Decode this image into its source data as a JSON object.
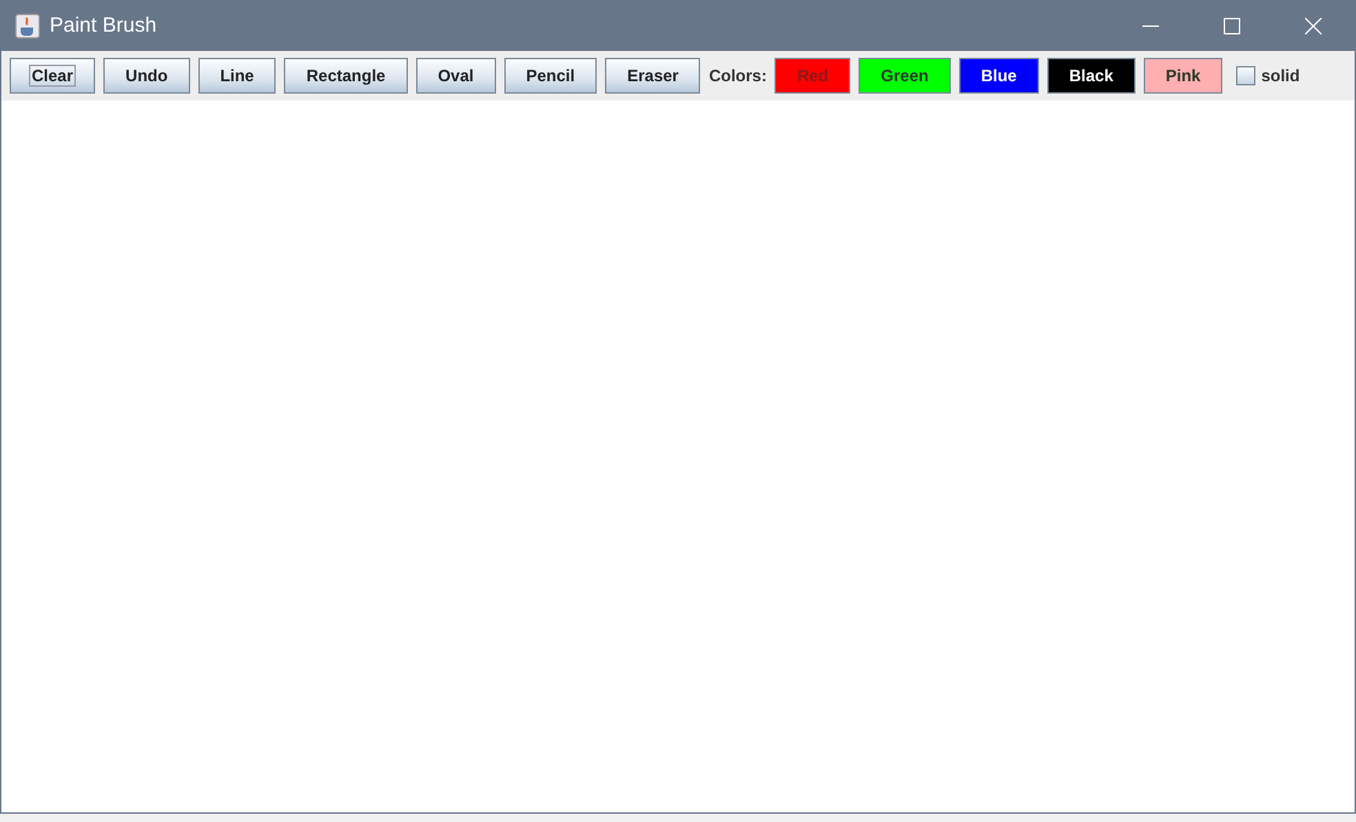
{
  "window": {
    "title": "Paint Brush"
  },
  "toolbar": {
    "buttons": [
      {
        "label": "Clear",
        "kind": "tool",
        "focused": true
      },
      {
        "label": "Undo",
        "kind": "tool",
        "focused": false
      },
      {
        "label": "Line",
        "kind": "tool",
        "focused": false
      },
      {
        "label": "Rectangle",
        "kind": "tool",
        "focused": false
      },
      {
        "label": "Oval",
        "kind": "tool",
        "focused": false
      },
      {
        "label": "Pencil",
        "kind": "tool",
        "focused": false
      },
      {
        "label": "Eraser",
        "kind": "tool",
        "focused": false
      }
    ],
    "colors_label": "Colors:",
    "colors": [
      {
        "label": "Red",
        "color": "#ff0000"
      },
      {
        "label": "Green",
        "color": "#00ff00"
      },
      {
        "label": "Blue",
        "color": "#0000ff"
      },
      {
        "label": "Black",
        "color": "#000000"
      },
      {
        "label": "Pink",
        "color": "#ffafaf"
      }
    ],
    "solid": {
      "label": "solid",
      "checked": false
    }
  }
}
